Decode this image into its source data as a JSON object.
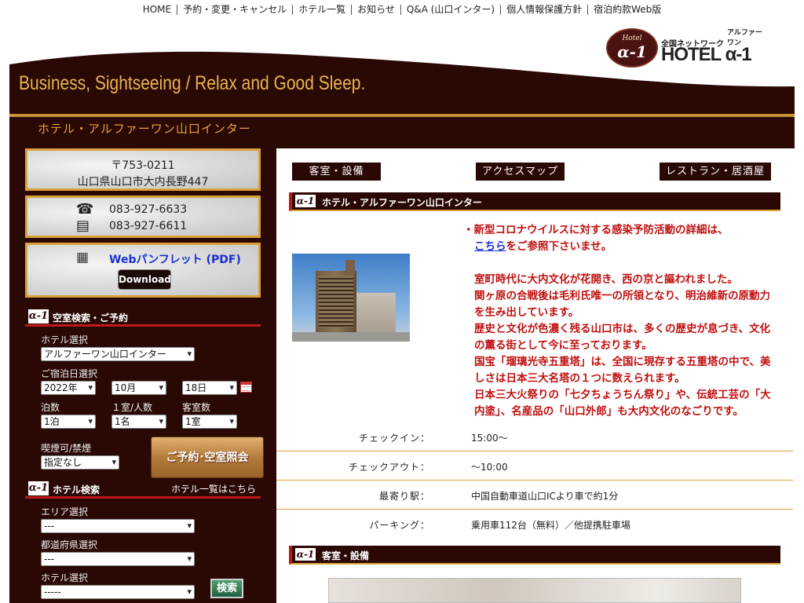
{
  "top_nav": [
    "HOME",
    "予約・変更・キャンセル",
    "ホテル一覧",
    "お知らせ",
    "Q&A (山口インター)",
    "個人情報保護方針",
    "宿泊約款Web版"
  ],
  "logo": {
    "seal_top": "Hotel",
    "seal_main": "α-1",
    "network": "全国ネットワーク",
    "ruby": "アルファーワン",
    "main": "HOTEL α-1"
  },
  "banner": {
    "tagline": "Business, Sightseeing / Relax and Good Sleep."
  },
  "hotel_title": "ホテル・アルファーワン山口インター",
  "sidebar": {
    "address": {
      "postal": "〒753-0211",
      "line": "山口県山口市大内長野447"
    },
    "phone": {
      "tel": "083-927-6633",
      "fax": "083-927-6611",
      "tel_icon": "telephone-icon",
      "fax_icon": "fax-icon"
    },
    "pamphlet": {
      "icon": "document-icon",
      "link": "Webパンフレット (PDF)",
      "download": "Download"
    },
    "reserve_head": {
      "mark": "α-1",
      "title": "空室検索・ご予約"
    },
    "reserve": {
      "hotel_label": "ホテル選択",
      "hotel_value": "アルファーワン山口インター",
      "date_label": "ご宿泊日選択",
      "year": "2022年",
      "month": "10月",
      "day": "18日",
      "nights_label": "泊数",
      "nights": "1泊",
      "persons_label": "１室/人数",
      "persons": "1名",
      "rooms_label": "客室数",
      "rooms": "1室",
      "smoking_label": "喫煙可/禁煙",
      "smoking": "指定なし",
      "button": "ご予約･空室照会"
    },
    "hotel_search_head": {
      "mark": "α-1",
      "title": "ホテル検索",
      "link": "ホテル一覧はこちら"
    },
    "hotel_search": {
      "area_label": "エリア選択",
      "area": "---",
      "pref_label": "都道府県選択",
      "pref": "---",
      "hotel_label": "ホテル選択",
      "hotel": "-----",
      "button": "検索"
    }
  },
  "main": {
    "tabs": [
      "客室・設備",
      "アクセスマップ",
      "レストラン・居酒屋"
    ],
    "section1": {
      "mark": "α-1",
      "title": "ホテル・アルファーワン山口インター"
    },
    "notice": {
      "covid1": "・新型コロナウイルスに対する感染予防活動の詳細は、",
      "link": "こちら",
      "covid2": "をご参照下さいませ。",
      "p1": "室町時代に大内文化が花開き、西の京と謳われました。",
      "p2": "関ヶ原の合戦後は毛利氏唯一の所領となり、明治維新の原動力を生み出しています。",
      "p3": "歴史と文化が色濃く残る山口市は、多くの歴史が息づき、文化の薫る街として今に至っております。",
      "p4": "国宝「瑠璃光寺五重塔」は、全国に現存する五重塔の中で、美しさは日本三大名塔の１つに数えられます。",
      "p5": "日本三大火祭りの「七夕ちょうちん祭り」や、伝統工芸の「大内塗」、名産品の「山口外郎」も大内文化のなごりです。"
    },
    "info": [
      {
        "key": "チェックイン：",
        "value": "15:00〜"
      },
      {
        "key": "チェックアウト：",
        "value": "〜10:00"
      },
      {
        "key": "最寄り駅：",
        "value": "中国自動車道山口ICより車で約1分"
      },
      {
        "key": "パーキング：",
        "value": "乗用車112台（無料）／他提携駐車場"
      }
    ],
    "section2": {
      "mark": "α-1",
      "title": "客室・設備"
    }
  }
}
